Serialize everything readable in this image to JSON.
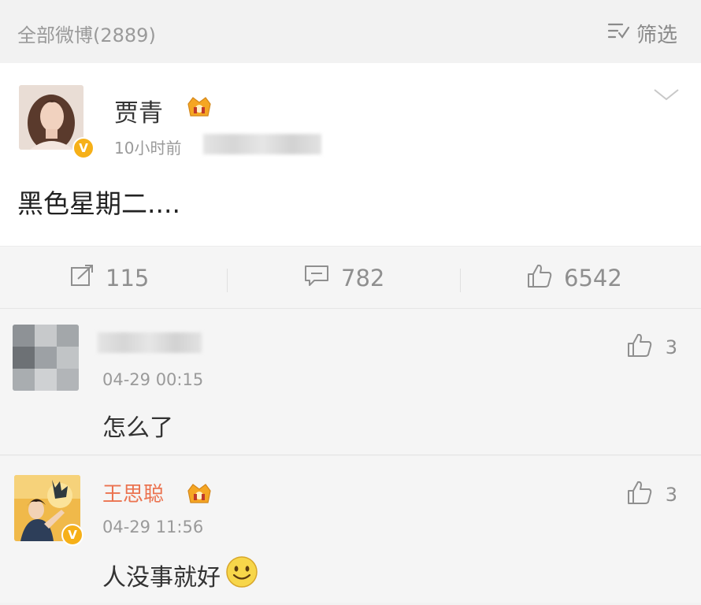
{
  "header": {
    "count_label": "全部微博(2889)",
    "filter_label": "筛选"
  },
  "post": {
    "author": "贾青",
    "time": "10小时前",
    "content": "黑色星期二....",
    "reposts": "115",
    "comments": "782",
    "likes": "6542"
  },
  "comments": [
    {
      "time": "04-29 00:15",
      "text": "怎么了",
      "likes": "3"
    },
    {
      "author": "王思聪",
      "time": "04-29 11:56",
      "text": "人没事就好",
      "likes": "3"
    }
  ],
  "colors": {
    "comment_author": "#eb7350",
    "verified_badge": "#f6b018",
    "muted_text": "#9a9a9a"
  },
  "icons": [
    "filter-icon",
    "chevron-down-icon",
    "repost-icon",
    "comment-icon",
    "thumbs-up-icon",
    "verified-icon",
    "vip-crown-icon",
    "smiley-icon"
  ]
}
